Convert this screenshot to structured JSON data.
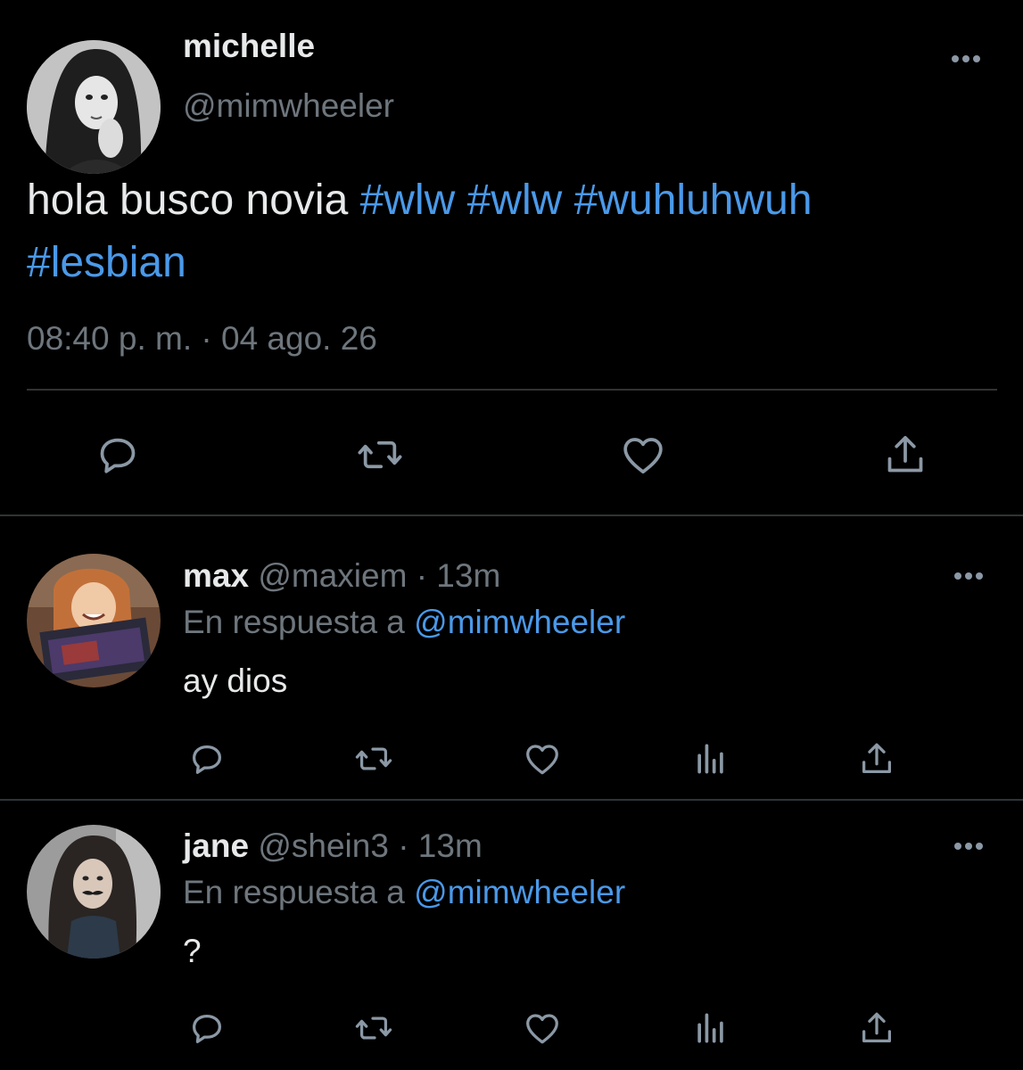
{
  "main_tweet": {
    "name": "michelle",
    "handle": "@mimwheeler",
    "text_plain": "hola busco novia ",
    "hashtags_line1": [
      "#wlw",
      "#wlw",
      "#wuhluhwuh"
    ],
    "hashtags_line2": [
      "#lesbian"
    ],
    "timestamp": "08:40 p. m. · 04 ago. 26",
    "actions": [
      "reply-icon",
      "retweet-icon",
      "like-icon",
      "share-icon"
    ]
  },
  "replies": [
    {
      "name": "max",
      "handle": "@maxiem",
      "time": "· 13m",
      "in_reply_prefix": "En respuesta a",
      "in_reply_handle": "@mimwheeler",
      "text": "ay dios"
    },
    {
      "name": "jane",
      "handle": "@shein3",
      "time": "· 13m",
      "in_reply_prefix": "En respuesta a",
      "in_reply_handle": "@mimwheeler",
      "text": "?"
    }
  ],
  "colors": {
    "background": "#000000",
    "text": "#e7e9ea",
    "muted": "#6e767d",
    "link": "#4a99e9",
    "divider": "#2f3336"
  }
}
